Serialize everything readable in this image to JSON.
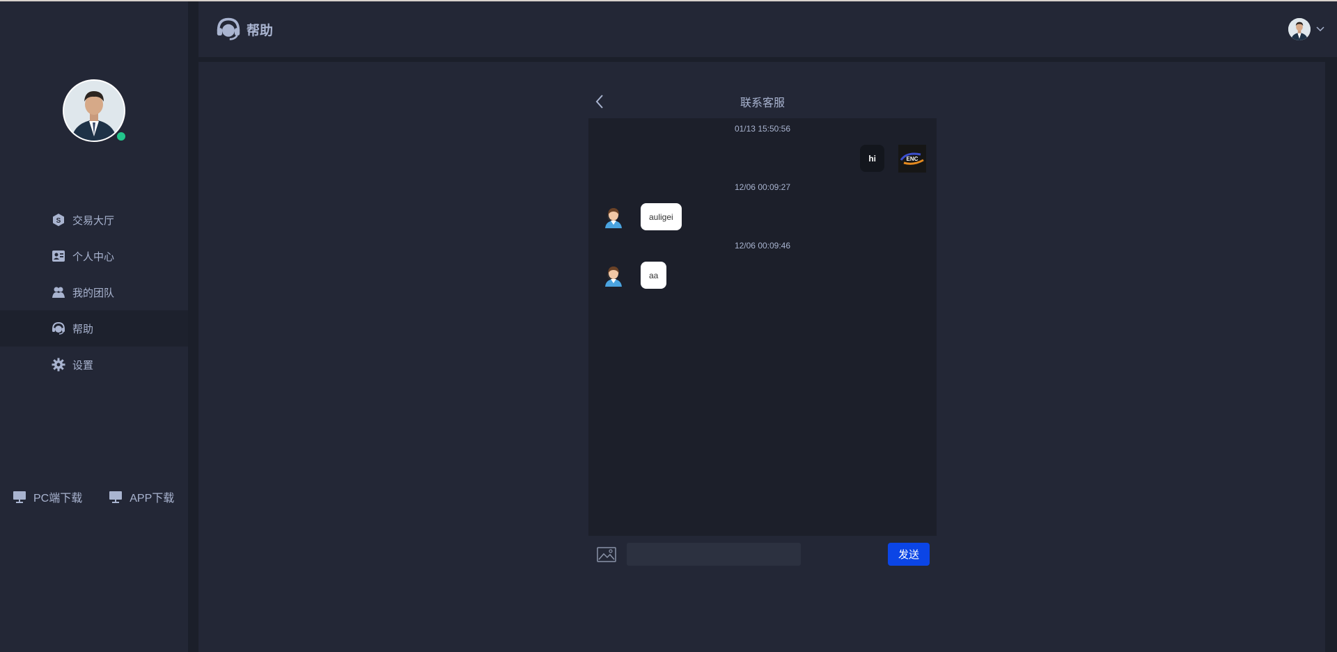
{
  "header": {
    "title": "帮助"
  },
  "sidebar": {
    "items": [
      {
        "label": "交易大厅",
        "icon": "exchange-icon"
      },
      {
        "label": "个人中心",
        "icon": "profile-card-icon"
      },
      {
        "label": "我的团队",
        "icon": "team-icon"
      },
      {
        "label": "帮助",
        "icon": "headset-icon",
        "active": true
      },
      {
        "label": "设置",
        "icon": "gear-icon"
      }
    ],
    "downloads": [
      {
        "label": "PC端下载",
        "icon": "monitor-icon"
      },
      {
        "label": "APP下载",
        "icon": "monitor-icon"
      }
    ],
    "online_color": "#22c58b"
  },
  "chat": {
    "title": "联系客服",
    "messages": [
      {
        "time": "01/13 15:50:56",
        "from": "me",
        "text": "hi"
      },
      {
        "time": "12/06 00:09:27",
        "from": "agent",
        "text": "auligei"
      },
      {
        "time": "12/06 00:09:46",
        "from": "agent",
        "text": "aa"
      }
    ],
    "me_avatar_text": "ENC",
    "input": {
      "value": "",
      "placeholder": ""
    },
    "send_label": "发送"
  },
  "colors": {
    "background": "#1b1f2a",
    "panel": "#232736",
    "chat_bg": "#1c1f2a",
    "accent": "#0b45e6",
    "text": "#a9b4d0"
  }
}
